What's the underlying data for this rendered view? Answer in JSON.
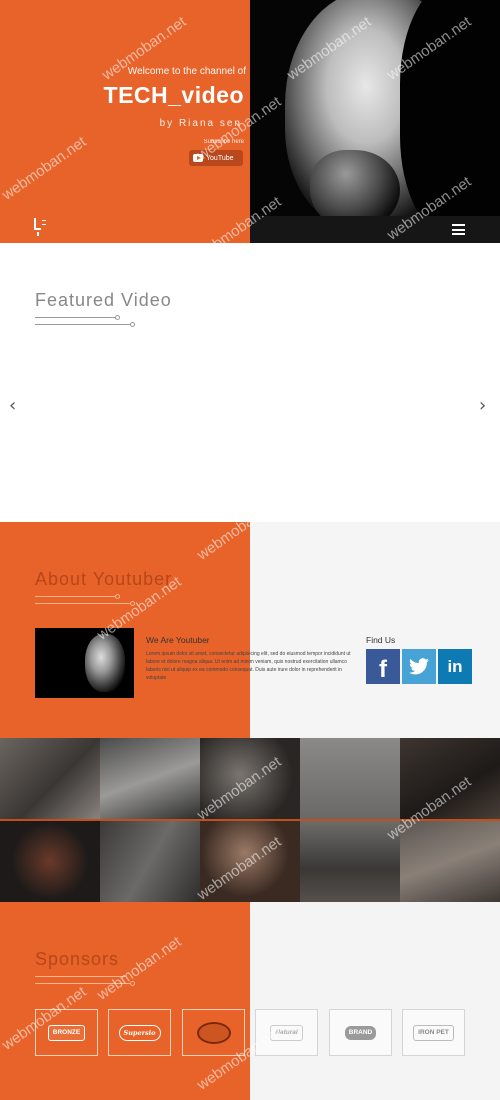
{
  "hero": {
    "welcome": "Welcome to the channel of",
    "title": "TECH_video",
    "byline": "by  Riana  sen",
    "subscribe": "Subscribe here",
    "youtube_button": "YouTube"
  },
  "featured": {
    "title": "Featured  Video",
    "prev": "‹",
    "next": "›"
  },
  "about": {
    "title": "About  Youtuber",
    "heading": "We Are Youtuber",
    "text": "Lorem ipsum dolor sit amet, consectetur adipisicing elit, sed do eiusmod tempor incididunt ut labore et dolore magna aliqua. Ut enim ad minim veniam, quis nostrud exercitation ullamco laboris nisi ut aliquip ex ea commodo consequat. Duis aute irure dolor in reprehenderit in voluptate",
    "find_us": "Find Us",
    "social": [
      "f",
      "t",
      "in"
    ]
  },
  "sponsors": {
    "title": "Sponsors",
    "logos": [
      "BRONZE",
      "Supersio",
      "",
      "Natural",
      "BRAND",
      "IRON PET"
    ]
  },
  "watermark": "webmoban.net",
  "colors": {
    "accent": "#e8632a",
    "facebook": "#3a5998",
    "twitter": "#47a2d6",
    "linkedin": "#0e7ab3"
  }
}
